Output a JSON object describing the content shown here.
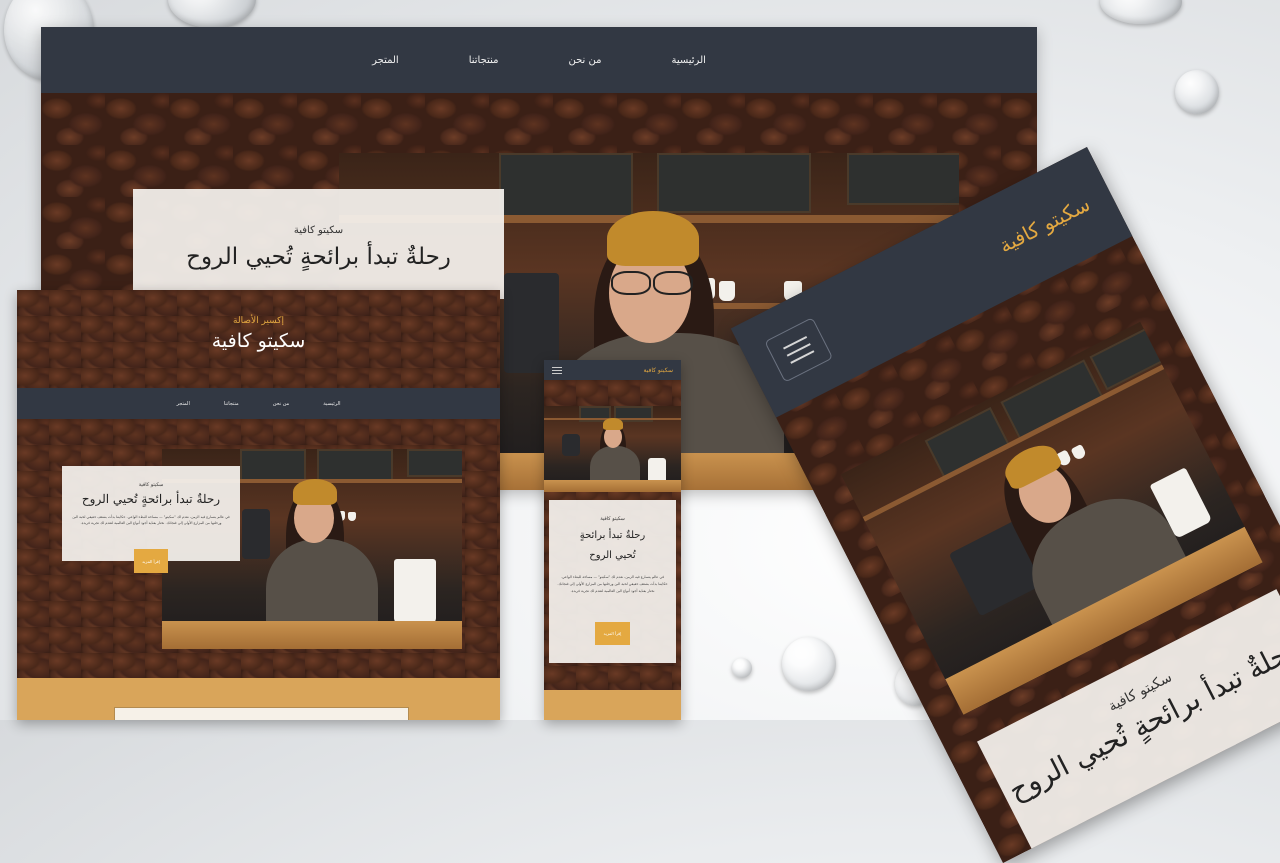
{
  "nav": {
    "items": [
      "الرئيسية",
      "من نحن",
      "منتجاتنا",
      "المتجر"
    ]
  },
  "hero": {
    "subtitle": "سكيتو كافية",
    "title": "رحلةٌ تبدأ برائحةٍ تُحيي الروح",
    "body": "في عالم يتسارع فيه الزمن، نقدم لك \"سكيتو\" — مساحة للبطء الواعي. حكايتنا بدأت بشغف حقيقي لحبة البن ورحلتها من المزارع الأولى إلى فنجانك. نختار بعناية أجود أنواع البن العالمية لتقدم لك تجربة فريدة.",
    "button": "إقرأ المزيد"
  },
  "brand": {
    "tagline": "إكسير الأصالة",
    "name": "سكيتو كافية"
  },
  "tablet": {
    "logo": "سكيتو كافية"
  },
  "mobile": {
    "logo": "سكيتو كافية"
  },
  "colors": {
    "nav": "#323843",
    "accent": "#e4a941",
    "card": "#f5f2ee"
  }
}
